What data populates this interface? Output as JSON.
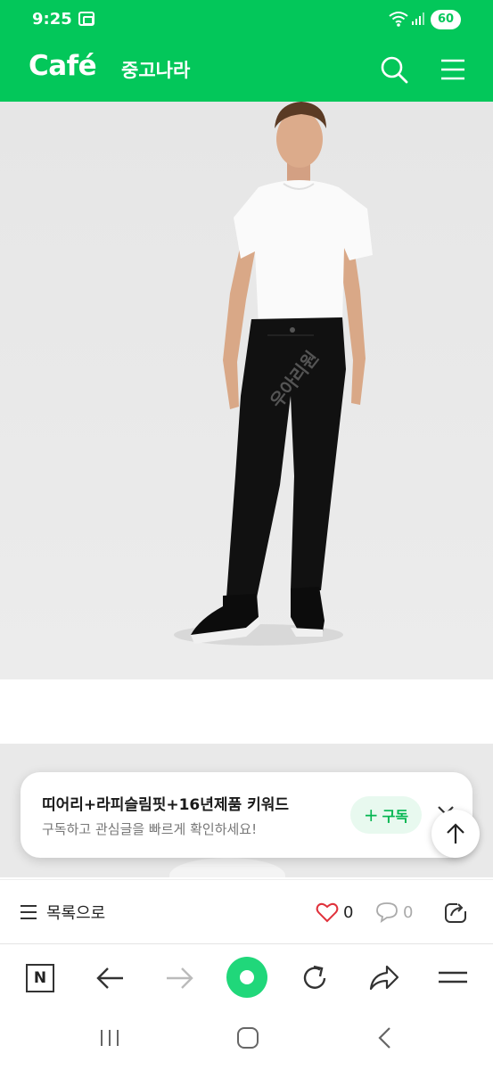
{
  "status_bar": {
    "time": "9:25",
    "battery": "60",
    "icons": [
      "screen-record-icon",
      "wifi-icon",
      "signal-icon",
      "battery-icon"
    ]
  },
  "app_header": {
    "logo": "Café",
    "cafe_name": "중고나라",
    "icons": [
      "search-icon",
      "hamburger-menu-icon"
    ],
    "color": "#03c75a"
  },
  "photo": {
    "watermark": "우아리원"
  },
  "subscribe_card": {
    "title": "띠어리+라피슬림핏+16년제품 키워드",
    "description": "구독하고 관심글을 빠르게 확인하세요!",
    "button_label": "구독"
  },
  "list_bar": {
    "back_label": "목록으로",
    "like_count": "0",
    "comment_count": "0"
  },
  "browser_nav": {
    "home_label": "N",
    "icons": [
      "naver-home-icon",
      "back-arrow-icon",
      "forward-arrow-icon",
      "green-dot-icon",
      "reload-icon",
      "share-icon",
      "menu-icon"
    ]
  },
  "system_nav": {
    "icons": [
      "recent-apps-icon",
      "home-icon",
      "back-icon"
    ]
  }
}
